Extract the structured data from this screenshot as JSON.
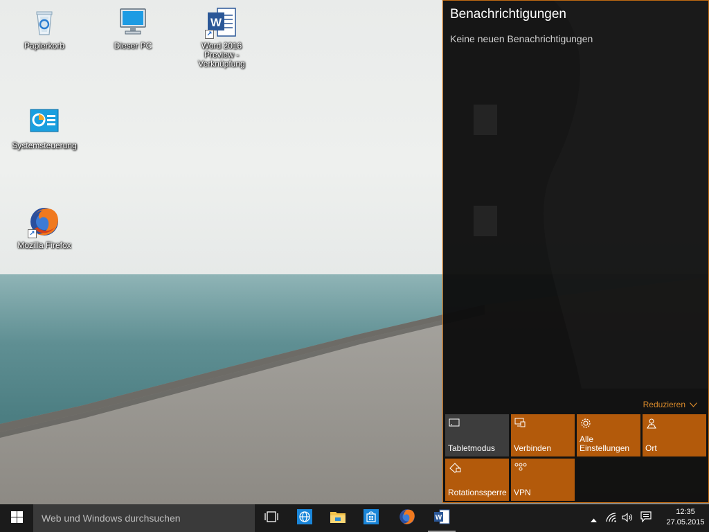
{
  "desktop": {
    "icons": [
      {
        "label": "Papierkorb",
        "icon": "recycle-bin-icon"
      },
      {
        "label": "Dieser PC",
        "icon": "computer-icon"
      },
      {
        "label": "Word 2016 Preview - Verknüpfung",
        "icon": "word-icon"
      },
      {
        "label": "Systemsteuerung",
        "icon": "control-panel-icon"
      },
      {
        "label": "Mozilla Firefox",
        "icon": "firefox-icon"
      }
    ]
  },
  "action_center": {
    "title": "Benachrichtigungen",
    "empty_text": "Keine neuen Benachrichtigungen",
    "collapse_label": "Reduzieren",
    "tiles": [
      {
        "label": "Tabletmodus",
        "icon": "tablet-mode-icon",
        "state": "off"
      },
      {
        "label": "Verbinden",
        "icon": "connect-icon",
        "state": "on"
      },
      {
        "label": "Alle Einstellungen",
        "icon": "gear-icon",
        "state": "on"
      },
      {
        "label": "Ort",
        "icon": "location-icon",
        "state": "on"
      },
      {
        "label": "Rotationssperre",
        "icon": "rotation-lock-icon",
        "state": "on"
      },
      {
        "label": "VPN",
        "icon": "vpn-icon",
        "state": "on"
      }
    ],
    "accent_color": "#b35a0b"
  },
  "taskbar": {
    "search_placeholder": "Web und Windows durchsuchen",
    "pinned": [
      "task-view-icon",
      "edge-icon",
      "file-explorer-icon",
      "store-icon",
      "firefox-icon",
      "word-icon"
    ],
    "time": "12:35",
    "date": "27.05.2015"
  }
}
